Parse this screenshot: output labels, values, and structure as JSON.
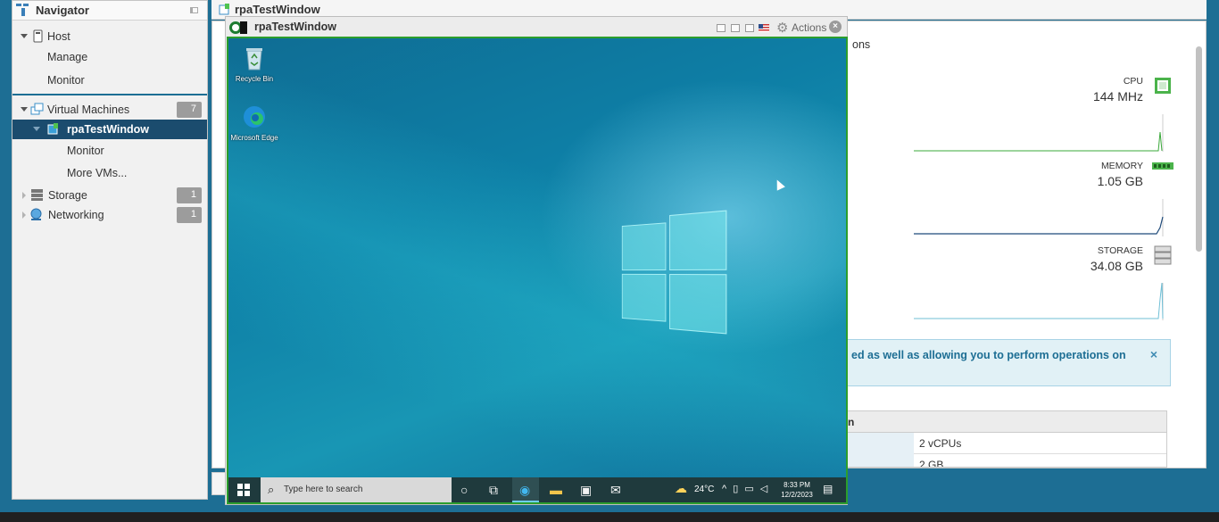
{
  "navigator": {
    "title": "Navigator",
    "items": [
      {
        "label": "Host"
      },
      {
        "label": "Manage"
      },
      {
        "label": "Monitor"
      },
      {
        "label": "Virtual Machines",
        "count": "7"
      },
      {
        "label": "rpaTestWindow"
      },
      {
        "label": "Monitor"
      },
      {
        "label": "More VMs..."
      },
      {
        "label": "Storage",
        "count": "1"
      },
      {
        "label": "Networking",
        "count": "1"
      }
    ]
  },
  "main": {
    "title": "rpaTestWindow",
    "partial_text": "ons",
    "resources": [
      {
        "label": "CPU",
        "value": "144 MHz",
        "icon": "cpu-icon"
      },
      {
        "label": "MEMORY",
        "value": "1.05 GB",
        "icon": "memory-icon"
      },
      {
        "label": "STORAGE",
        "value": "34.08 GB",
        "icon": "storage-icon"
      }
    ],
    "info_banner": {
      "text": "ed as well as allowing you to perform operations on",
      "close": "×"
    },
    "hardware": {
      "header": "n",
      "rows": [
        {
          "value": "2 vCPUs"
        },
        {
          "value": "2 GB"
        }
      ]
    }
  },
  "console": {
    "title": "rpaTestWindow",
    "actions_label": "Actions",
    "close_glyph": "×",
    "desktop_icons": [
      {
        "label": "Recycle Bin"
      },
      {
        "label": "Microsoft Edge"
      }
    ],
    "taskbar": {
      "search_placeholder": "Type here to search",
      "temperature": "24°C",
      "time": "8:33 PM",
      "date": "12/2/2023"
    }
  },
  "colors": {
    "selected_nav": "#1b4c6e",
    "console_border": "#2c9e2c",
    "accent": "#1d6e94"
  }
}
